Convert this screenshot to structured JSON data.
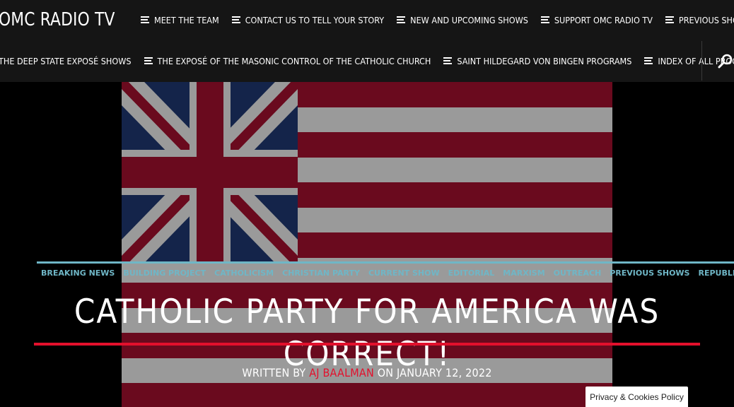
{
  "site": {
    "title": "OMC RADIO TV"
  },
  "nav_primary": [
    "MEET THE TEAM",
    "CONTACT US TO TELL YOUR STORY",
    "NEW AND UPCOMING SHOWS",
    "SUPPORT OMC RADIO TV",
    "PREVIOUS SHOWS"
  ],
  "nav_secondary": [
    "THE DEEP STATE EXPOSÉ SHOWS",
    "THE EXPOSÉ OF THE MASONIC CONTROL OF THE CATHOLIC CHURCH",
    "SAINT HILDEGARD VON BINGEN PROGRAMS",
    "INDEX OF ALL PROGRAMS"
  ],
  "search": {
    "icon": "search-icon"
  },
  "post": {
    "categories": [
      "BREAKING NEWS",
      "BUILDING PROJECT",
      "CATHOLICISM",
      "CHRISTIAN PARTY",
      "CURRENT SHOW",
      "EDITORIAL",
      "MARXISM",
      "OUTREACH",
      "PREVIOUS SHOWS",
      "REPUBLIC"
    ],
    "title": "CATHOLIC PARTY FOR AMERICA WAS CORRECT!",
    "written_by": "WRITTEN BY",
    "author": "AJ BAALMAN",
    "on": "ON",
    "date": "JANUARY 12, 2022"
  },
  "cookie_notice": "Privacy & Cookies Policy",
  "colors": {
    "accent_red": "#e3102c",
    "category_teal": "#6fb6c6",
    "flag_red": "#6a0a1e",
    "flag_gray": "#9a9a9a",
    "flag_blue": "#14244a"
  }
}
